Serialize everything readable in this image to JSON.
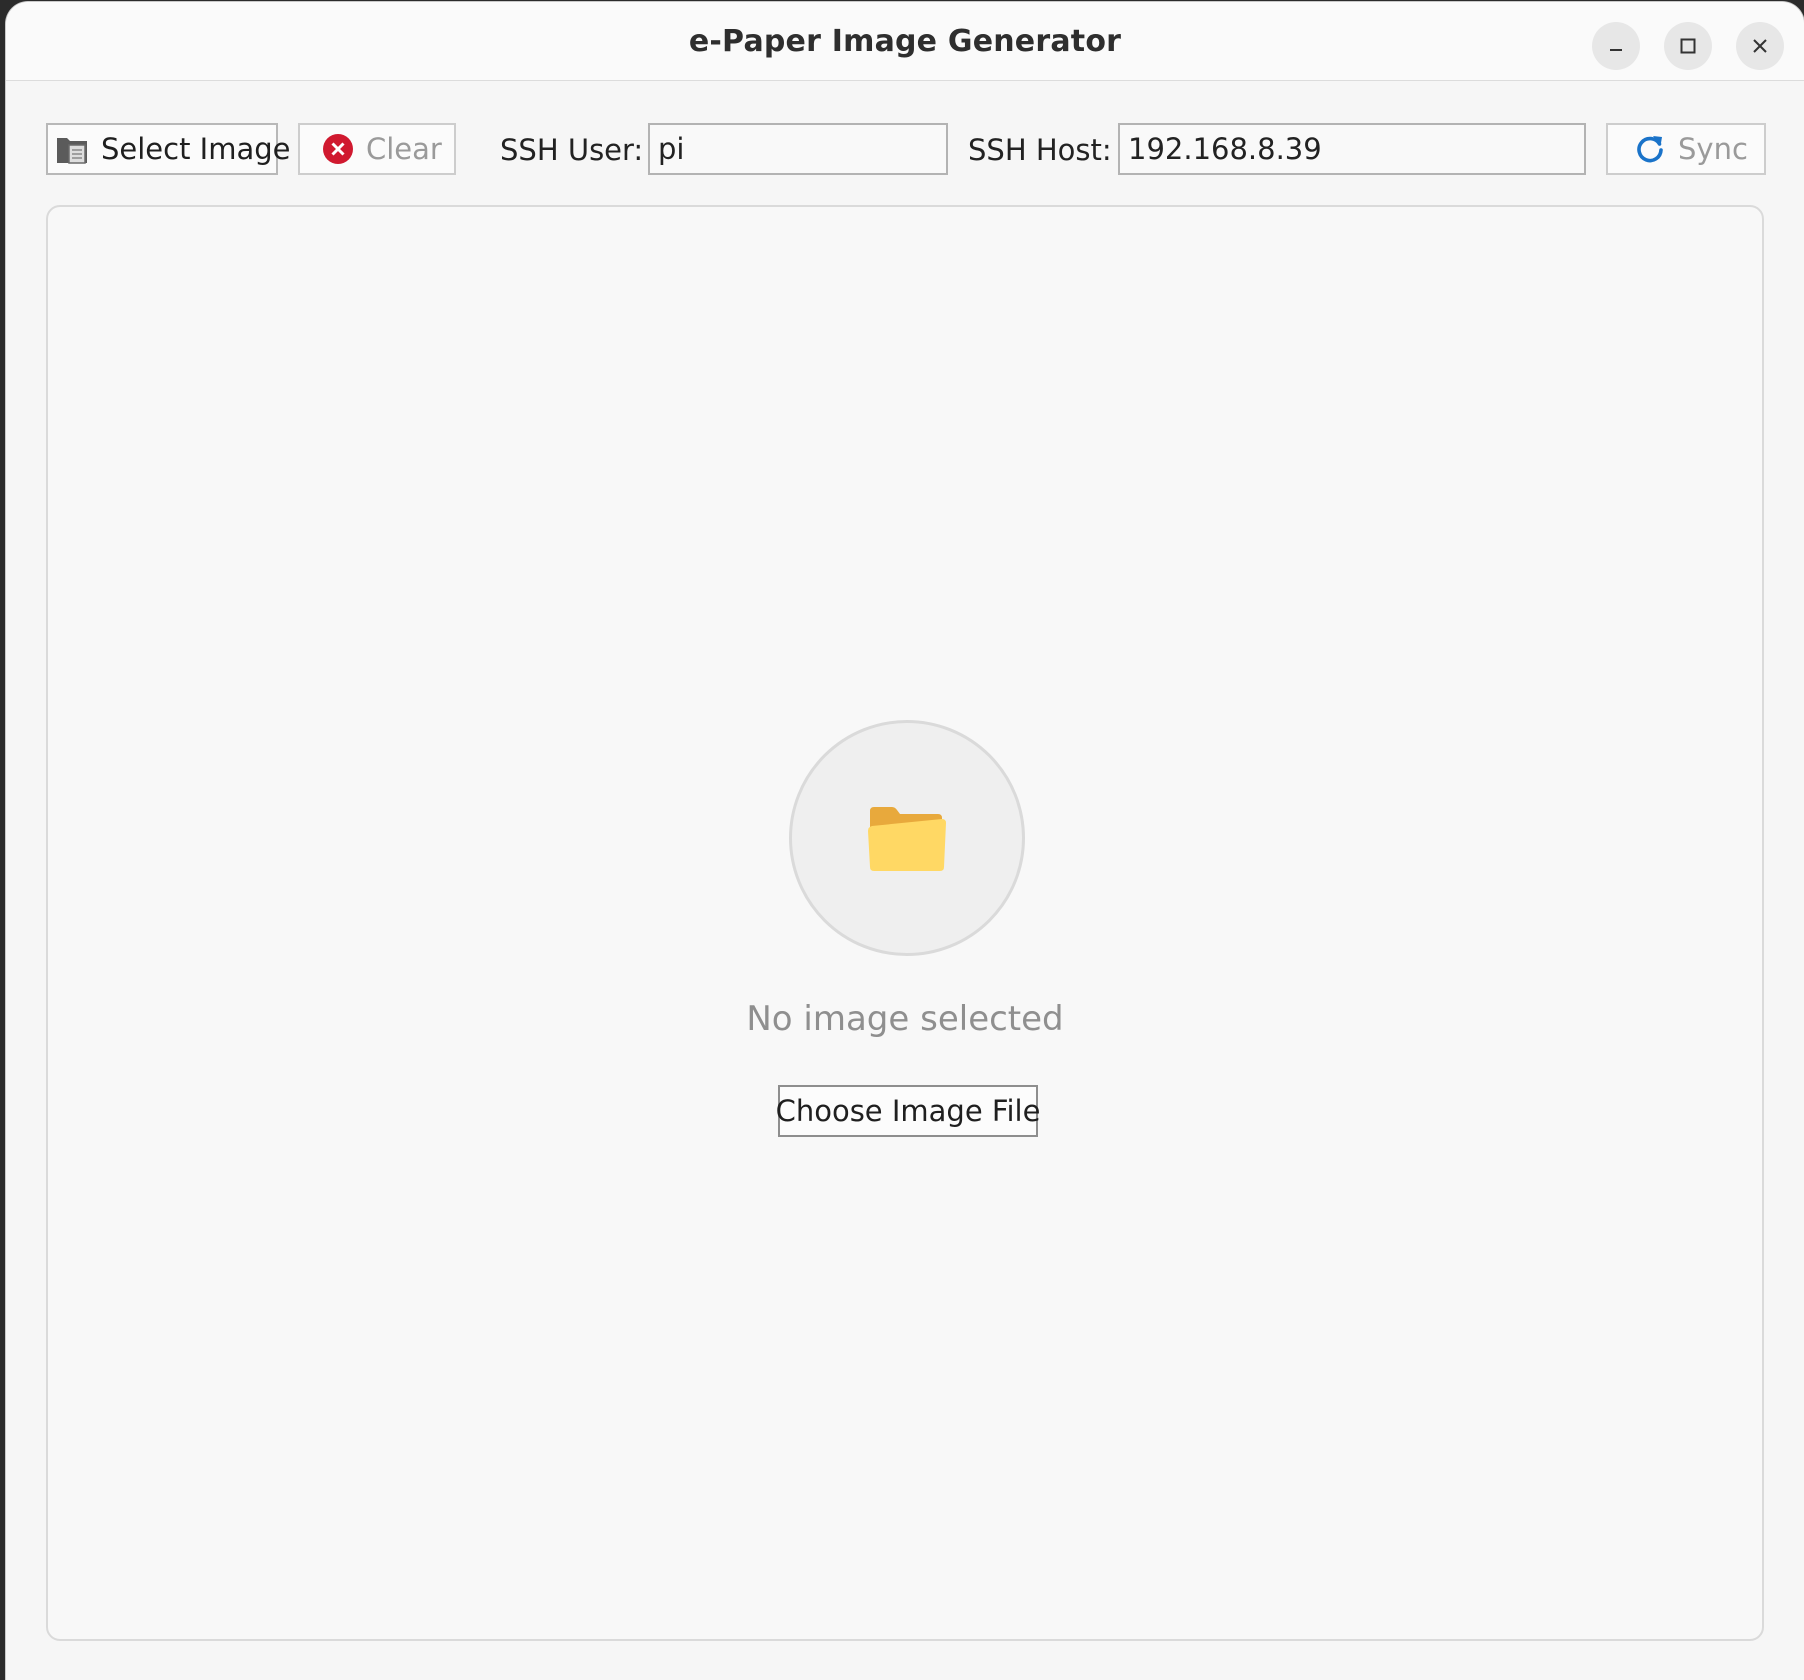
{
  "window": {
    "title": "e-Paper Image Generator",
    "controls": [
      "minimize-icon",
      "maximize-icon",
      "close-icon"
    ]
  },
  "toolbar": {
    "select_image_label": "Select Image",
    "select_image_icon": "file-folder-icon",
    "clear_label": "Clear",
    "clear_icon": "close-circle-icon",
    "clear_icon_color": "#d0192f",
    "ssh_user_label": "SSH User:",
    "ssh_user_value": "pi",
    "ssh_host_label": "SSH Host:",
    "ssh_host_value": "192.168.8.39",
    "sync_label": "Sync",
    "sync_icon": "refresh-icon",
    "sync_icon_color": "#1a73c9"
  },
  "preview": {
    "placeholder_icon": "folder-icon",
    "empty_text": "No image selected",
    "choose_button_label": "Choose Image File"
  }
}
